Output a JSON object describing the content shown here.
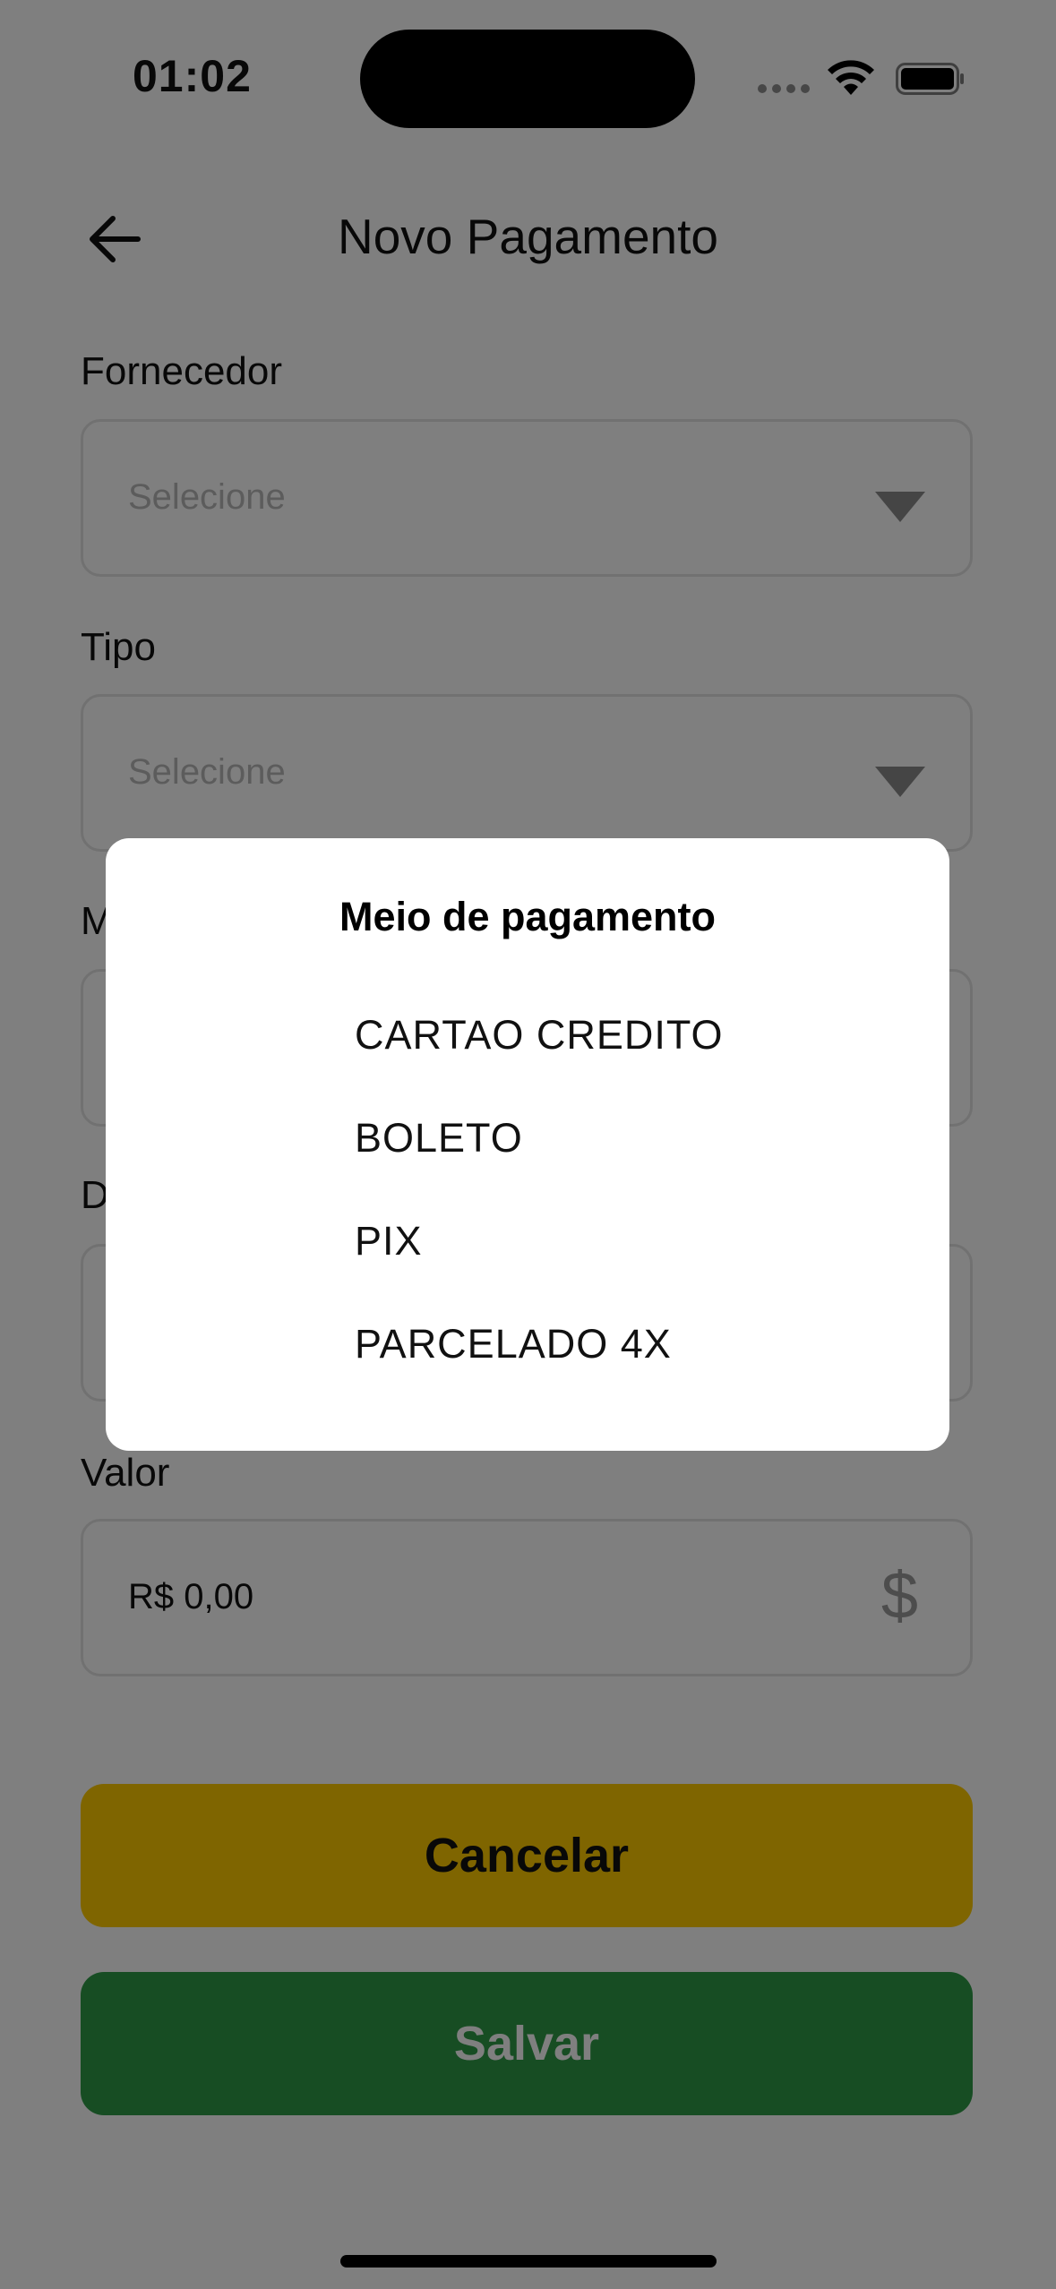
{
  "status": {
    "time": "01:02"
  },
  "header": {
    "title": "Novo Pagamento"
  },
  "form": {
    "fornecedor": {
      "label": "Fornecedor",
      "placeholder": "Selecione"
    },
    "tipo": {
      "label": "Tipo",
      "placeholder": "Selecione"
    },
    "meio": {
      "label_initial": "M"
    },
    "data": {
      "label_initial": "D"
    },
    "valor": {
      "label": "Valor",
      "value": "R$ 0,00",
      "icon": "$"
    }
  },
  "buttons": {
    "cancel": "Cancelar",
    "save": "Salvar"
  },
  "dialog": {
    "title": "Meio de pagamento",
    "options": [
      "CARTAO CREDITO",
      "BOLETO",
      "PIX",
      "PARCELADO 4X"
    ]
  },
  "colors": {
    "cancel_bg": "#ffcb00",
    "save_bg": "#2e9b47",
    "overlay": "rgba(0,0,0,0.5)"
  }
}
